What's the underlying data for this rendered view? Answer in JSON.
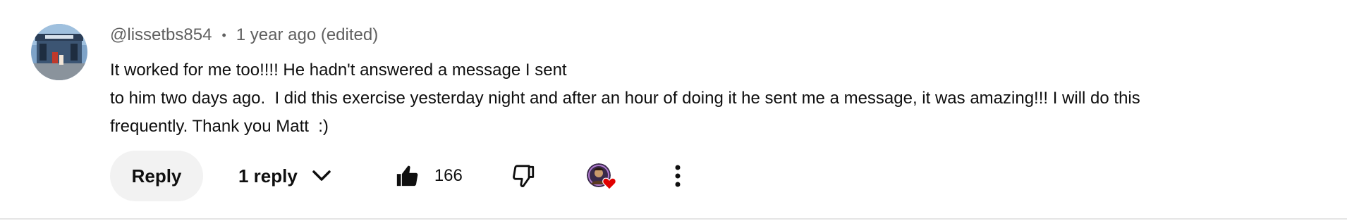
{
  "comment": {
    "author": "@lissetbs854",
    "separator": "•",
    "timestamp": "1 year ago (edited)",
    "text_lines": [
      "It worked for me too!!!! He hadn't answered a message I sent",
      "to him two days ago.  I did this exercise yesterday night and after an hour of doing it he sent me a message, it was amazing!!! I will do this",
      "frequently. Thank you Matt  :)"
    ]
  },
  "actions": {
    "reply_label": "Reply",
    "replies_label": "1 reply",
    "like_count": "166"
  },
  "icons": {
    "avatar": "user-avatar-photo",
    "expand": "chevron-down-icon",
    "like": "thumbs-up-icon",
    "dislike": "thumbs-down-icon",
    "creator_heart": "creator-heart-badge",
    "more": "more-vertical-icon"
  },
  "colors": {
    "meta_text": "#606060",
    "reply_bg": "#f2f2f2",
    "heart": "#e00000"
  }
}
